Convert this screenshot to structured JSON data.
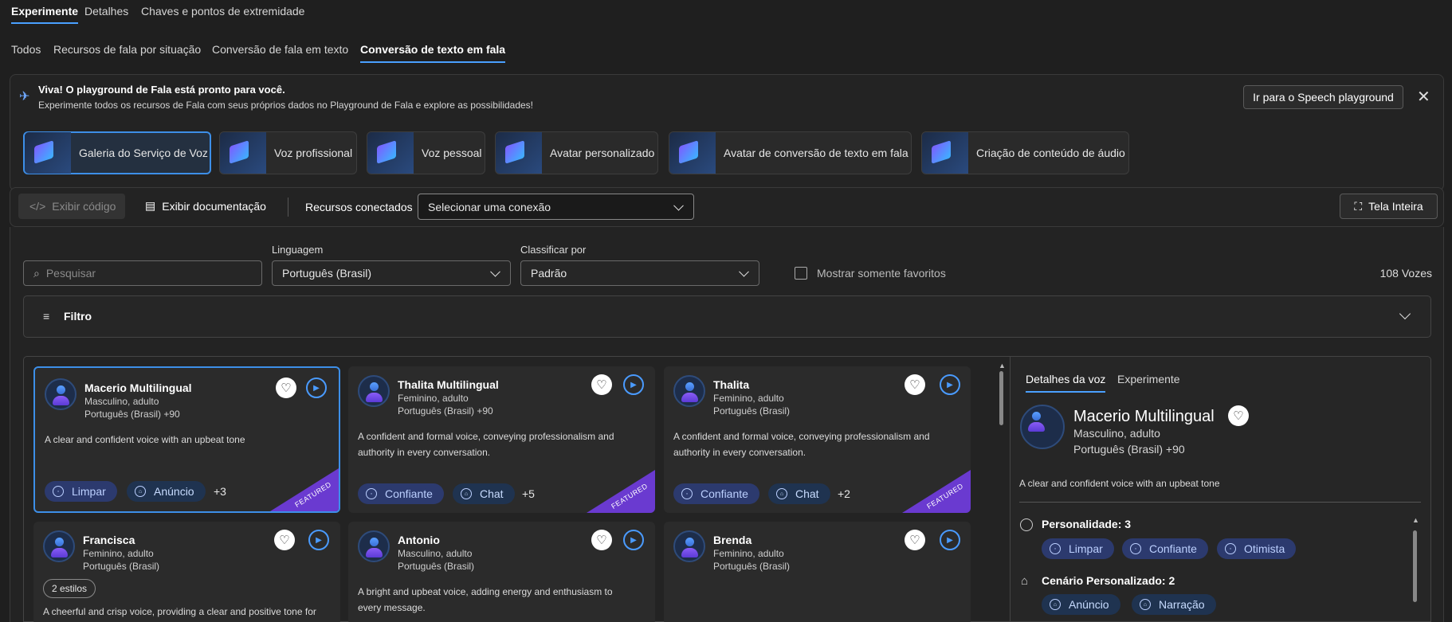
{
  "tabs_top": [
    "Experimente",
    "Detalhes",
    "Chaves e pontos de extremidade"
  ],
  "tabs_sub": [
    "Todos",
    "Recursos de fala por situação",
    "Conversão de fala em texto",
    "Conversão de texto em fala"
  ],
  "banner": {
    "title": "Viva! O playground de Fala está pronto para você.",
    "text": "Experimente todos os recursos de Fala com seus próprios dados no Playground de Fala e explore as possibilidades!",
    "button": "Ir para o Speech playground"
  },
  "capabilities": [
    "Galeria do Serviço de Voz",
    "Voz profissional",
    "Voz pessoal",
    "Avatar personalizado",
    "Avatar de conversão de texto em fala",
    "Criação de conteúdo de áudio"
  ],
  "toolbar": {
    "view_code": "Exibir código",
    "view_docs": "Exibir documentação",
    "connected": "Recursos conectados",
    "select_placeholder": "Selecionar uma conexão",
    "fullscreen": "Tela Inteira"
  },
  "filters": {
    "search_placeholder": "Pesquisar",
    "lang_label": "Linguagem",
    "lang_value": "Português (Brasil)",
    "sort_label": "Classificar por",
    "sort_value": "Padrão",
    "favorites": "Mostrar somente favoritos",
    "count": "108 Vozes",
    "filter": "Filtro"
  },
  "cards": [
    {
      "name": "Macerio Multilingual",
      "sub1": "Masculino, adulto",
      "sub2": "Português (Brasil) +90",
      "desc": "A clear and confident voice with an upbeat tone",
      "tags": [
        "Limpar",
        "Anúncio"
      ],
      "more": "+3",
      "featured": "FEATURED"
    },
    {
      "name": "Thalita Multilingual",
      "sub1": "Feminino, adulto",
      "sub2": "Português (Brasil) +90",
      "desc": "A confident and formal voice, conveying professionalism and authority in every conversation.",
      "tags": [
        "Confiante",
        "Chat"
      ],
      "more": "+5",
      "featured": "FEATURED"
    },
    {
      "name": "Thalita",
      "sub1": "Feminino, adulto",
      "sub2": "Português (Brasil)",
      "desc": "A confident and formal voice, conveying professionalism and authority in every conversation.",
      "tags": [
        "Confiante",
        "Chat"
      ],
      "more": "+2",
      "featured": "FEATURED"
    },
    {
      "name": "Francisca",
      "sub1": "Feminino, adulto",
      "sub2": "Português (Brasil)",
      "pill": "2 estilos",
      "desc": "A cheerful and crisp voice, providing a clear and positive tone for"
    },
    {
      "name": "Antonio",
      "sub1": "Masculino, adulto",
      "sub2": "Português (Brasil)",
      "desc": "A bright and upbeat voice, adding energy and enthusiasm to every message."
    },
    {
      "name": "Brenda",
      "sub1": "Feminino, adulto",
      "sub2": "Português (Brasil)"
    }
  ],
  "details": {
    "tab1": "Detalhes da voz",
    "tab2": "Experimente",
    "name": "Macerio Multilingual",
    "sub1": "Masculino, adulto",
    "sub2": "Português (Brasil) +90",
    "desc": "A clear and confident voice with an upbeat tone",
    "personality_label": "Personalidade: 3",
    "personality": [
      "Limpar",
      "Confiante",
      "Otimista"
    ],
    "scenario_label": "Cenário Personalizado: 2",
    "scenario": [
      "Anúncio",
      "Narração"
    ]
  }
}
